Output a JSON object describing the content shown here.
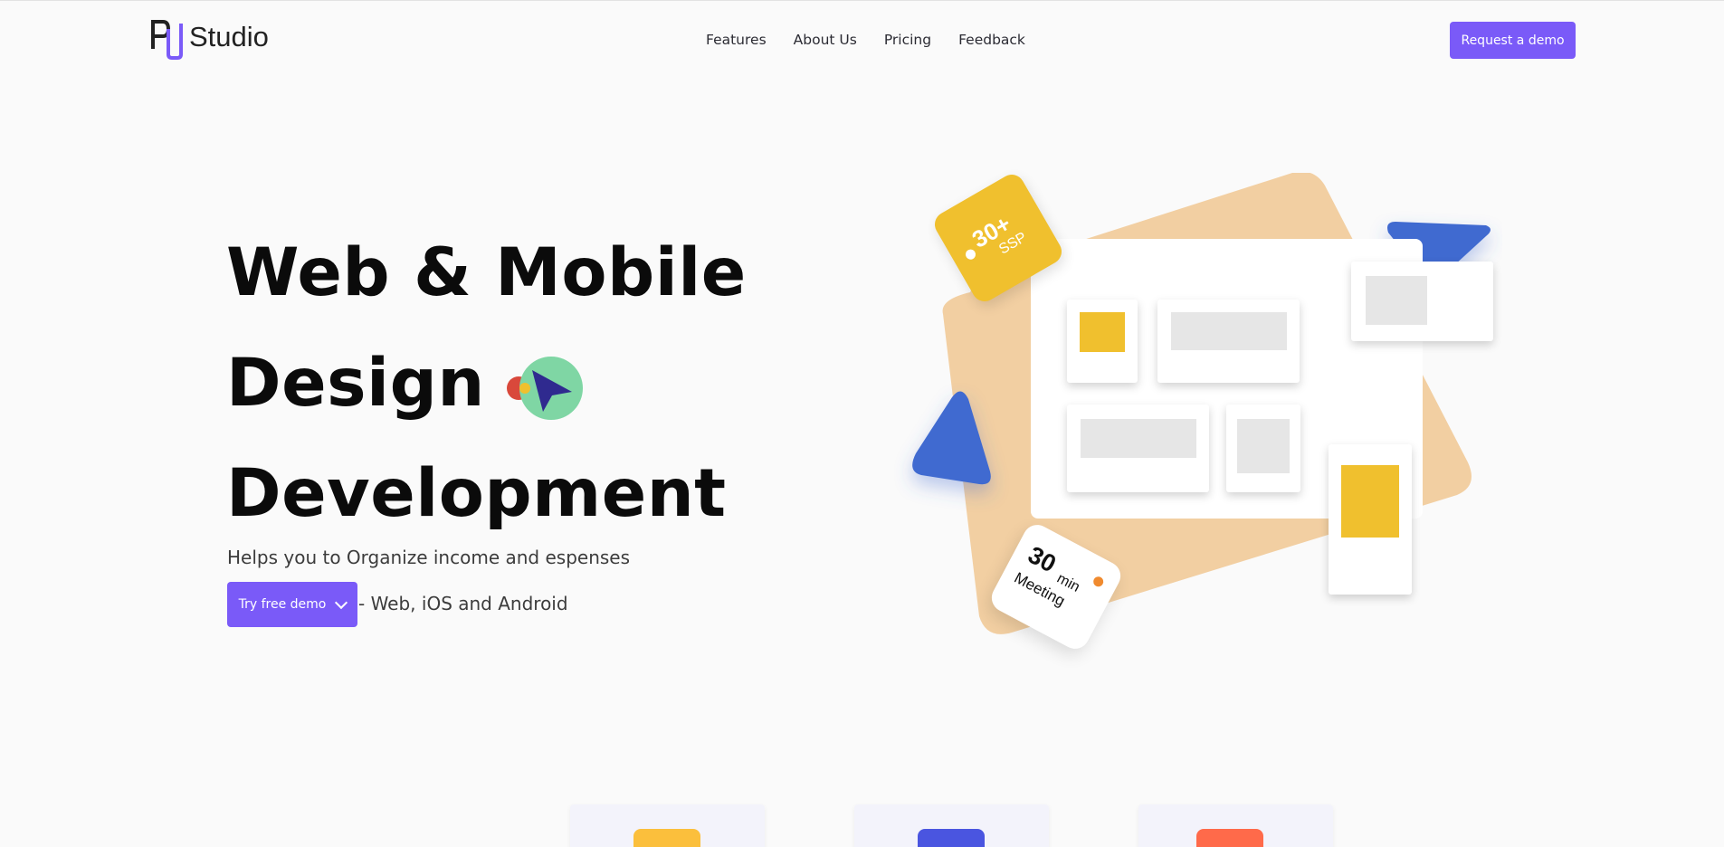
{
  "brand": {
    "name": "Studio",
    "accent": "#7a5af8"
  },
  "nav": {
    "items": [
      "Features",
      "About Us",
      "Pricing",
      "Feedback"
    ]
  },
  "header": {
    "cta_label": "Request a demo"
  },
  "hero": {
    "line1": "Web & Mobile",
    "line2": "Design",
    "line3": "Development",
    "subtitle": "Helps you to Organize income and espenses",
    "cta_label": "Try free demo",
    "platforms": "- Web, iOS and Android"
  },
  "illustration": {
    "ssp_badge": {
      "number": "30+",
      "label": "SSP"
    },
    "meeting_badge": {
      "number": "30",
      "unit": "min",
      "label": "Meeting"
    },
    "colors": {
      "backdrop": "#f2cfa2",
      "yellow": "#f0c02e",
      "blue": "#3f6ad0",
      "placeholder": "#e6e6e6"
    }
  },
  "features_cards": {
    "icons": [
      "document-icon",
      "layers-icon",
      "chat-icon"
    ],
    "colors": [
      "#fbbf3c",
      "#4a55e0",
      "#ff6a4a"
    ]
  }
}
